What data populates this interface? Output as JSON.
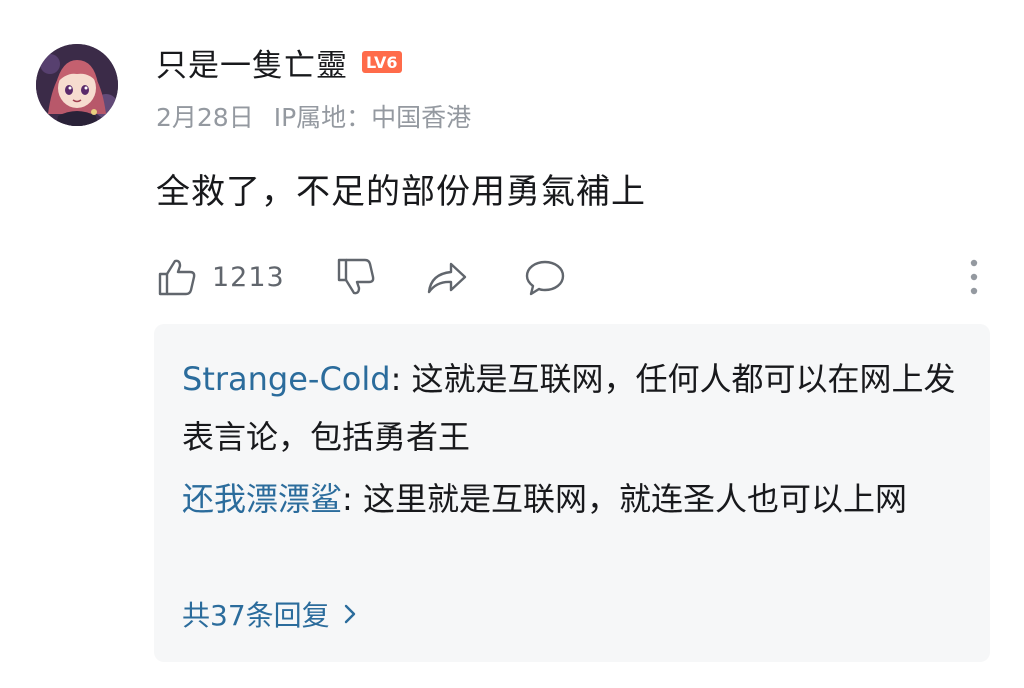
{
  "comment": {
    "username": "只是一隻亡靈",
    "level": "LV6",
    "date": "2月28日",
    "ip_location": "IP属地：中国香港",
    "content": "全救了，不足的部份用勇氣補上",
    "like_count": "1213",
    "icons": {
      "like": "thumbs-up-icon",
      "dislike": "thumbs-down-icon",
      "share": "share-icon",
      "reply": "comment-icon",
      "more": "more-vertical-icon"
    }
  },
  "replies": [
    {
      "author": "Strange-Cold",
      "separator": ":",
      "text": " 这就是互联网，任何人都可以在网上发表言论，包括勇者王"
    },
    {
      "author": "还我漂漂鲨",
      "separator": ":",
      "text": " 这里就是互联网，就连圣人也可以上网"
    }
  ],
  "more_replies_label": "共37条回复",
  "colors": {
    "level_badge": "#ff6b4a",
    "link": "#2b6c9c",
    "meta_text": "#9499a0",
    "reply_bg": "#f6f7f8"
  }
}
